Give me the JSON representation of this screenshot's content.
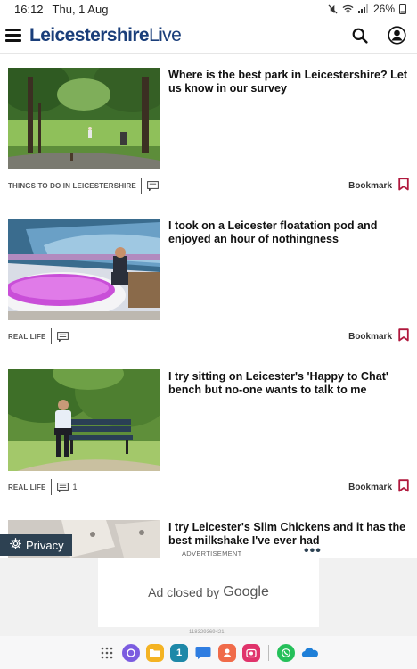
{
  "status_bar": {
    "time": "16:12",
    "date": "Thu, 1 Aug",
    "battery": "26%"
  },
  "header": {
    "logo_bold": "Leicestershire",
    "logo_light": "Live"
  },
  "articles": [
    {
      "headline": "Where is the best park in Leicestershire? Let us know in our survey",
      "tag": "THINGS TO DO IN LEICESTERSHIRE",
      "comments": "",
      "bookmark_label": "Bookmark"
    },
    {
      "headline": "I took on a Leicester floatation pod and enjoyed an hour of nothingness",
      "tag": "REAL LIFE",
      "comments": "",
      "bookmark_label": "Bookmark"
    },
    {
      "headline": "I try sitting on Leicester's 'Happy to Chat' bench but no-one wants to talk to me",
      "tag": "REAL LIFE",
      "comments": "1",
      "bookmark_label": "Bookmark"
    },
    {
      "headline": "I try Leicester's Slim Chickens and it has the best milkshake I've ever had"
    }
  ],
  "privacy": {
    "label": "Privacy"
  },
  "ad": {
    "label": "ADVERTISEMENT",
    "closed_text": "Ad closed by",
    "closed_brand": "Google",
    "id": "118329369421"
  },
  "dock": {
    "calendar_day": "1"
  },
  "colors": {
    "brand_blue": "#1a3e7a",
    "bookmark_red": "#b0183d",
    "privacy_bg": "#2d4152"
  }
}
